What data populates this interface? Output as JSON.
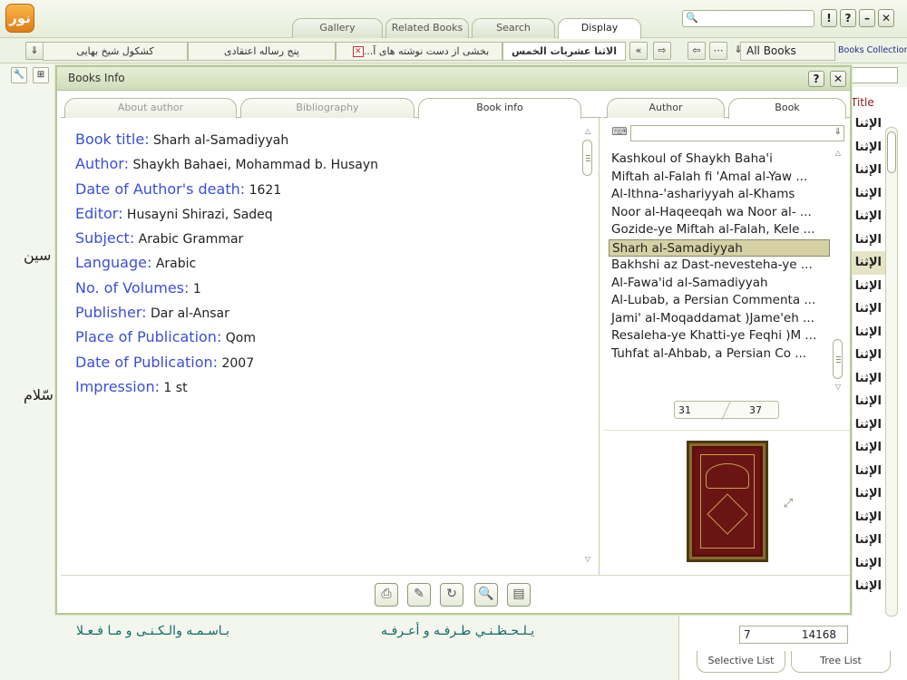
{
  "app": {
    "logo_text": "نور"
  },
  "top_tabs": [
    "Gallery",
    "Related Books",
    "Search",
    "Display"
  ],
  "window_buttons": [
    "!",
    "?",
    "–",
    "✕"
  ],
  "doc_tabs": [
    {
      "label": "الاثنا عشريات الخمس",
      "active": true
    },
    {
      "label": "بخشی از دست نوشته های آ...",
      "active": false
    },
    {
      "label": "پنج رساله اعتقادی",
      "active": false
    },
    {
      "label": "کشکول شیخ بهایی",
      "active": false
    }
  ],
  "collection": {
    "selected": "All Books",
    "label": "Books Collection"
  },
  "background": {
    "arabic_left_1": "سين",
    "arabic_left_2": "سّلام",
    "bottom_text_1": "يـلـحـظـنـي طـرفـه و أعـرفـه",
    "bottom_text_2": "بـاسـمـه والـكـنـى و مـا فـعـلا",
    "column_title": "Title",
    "arabic_list": [
      "الإثنا",
      "الإثنا",
      "الإثنا",
      "الإثنا",
      "الإثنا",
      "الإثنا",
      "الإثنا",
      "الإثنا",
      "الإثنا",
      "الإثنا",
      "الإثنا",
      "الإثنا",
      "الإثنا",
      "الإثنا",
      "الإثنا",
      "الإثنا",
      "الإثنا",
      "الإثنا",
      "الإثنا",
      "الإثنا",
      "الإثنا"
    ],
    "pager_current": "7",
    "pager_total": "14168",
    "bottom_tabs": [
      "Selective List",
      "Tree List"
    ]
  },
  "dialog": {
    "title": "Books Info",
    "main_tabs": [
      "About author",
      "Bibliography",
      "Book info"
    ],
    "side_tabs": [
      "Author",
      "Book"
    ],
    "info": [
      {
        "key": "Book title:",
        "value": "Sharh al-Samadiyyah"
      },
      {
        "key": "Author:",
        "value": "Shaykh Bahaei, Mohammad b. Husayn"
      },
      {
        "key": "Date of Author's death:",
        "value": "1621"
      },
      {
        "key": "Editor:",
        "value": "Husayni Shirazi, Sadeq"
      },
      {
        "key": "Subject:",
        "value": "Arabic Grammar"
      },
      {
        "key": "Language:",
        "value": "Arabic"
      },
      {
        "key": "No. of Volumes:",
        "value": "1"
      },
      {
        "key": "Publisher:",
        "value": "Dar al-Ansar"
      },
      {
        "key": "Place of Publication:",
        "value": "Qom"
      },
      {
        "key": "Date of Publication:",
        "value": "2007"
      },
      {
        "key": "Impression:",
        "value": "1 st"
      }
    ],
    "book_list": [
      "Kashkoul of Shaykh Baha'i",
      "Miftah al-Falah fi 'Amal al-Yaw ...",
      "Al-Ithna-'ashariyyah al-Khams",
      "Noor al-Haqeeqah wa Noor al- ...",
      "Gozide-ye Miftah al-Falah, Kele ...",
      "Sharh al-Samadiyyah",
      "Bakhshi az Dast-nevesteha-ye ...",
      "Al-Fawa'id al-Samadiyyah",
      "Al-Lubab, a Persian Commenta ...",
      "Jami' al-Moqaddamat )Jame'eh ...",
      "Resaleha-ye Khatti-ye Feqhi )M ...",
      "Tuhfat al-Ahbab, a Persian Co ..."
    ],
    "selected_index": 5,
    "pager_current": "31",
    "pager_total": "37",
    "footer_icons": [
      "printer-icon",
      "edit-icon",
      "export-icon",
      "zoom-icon",
      "notes-icon"
    ]
  }
}
